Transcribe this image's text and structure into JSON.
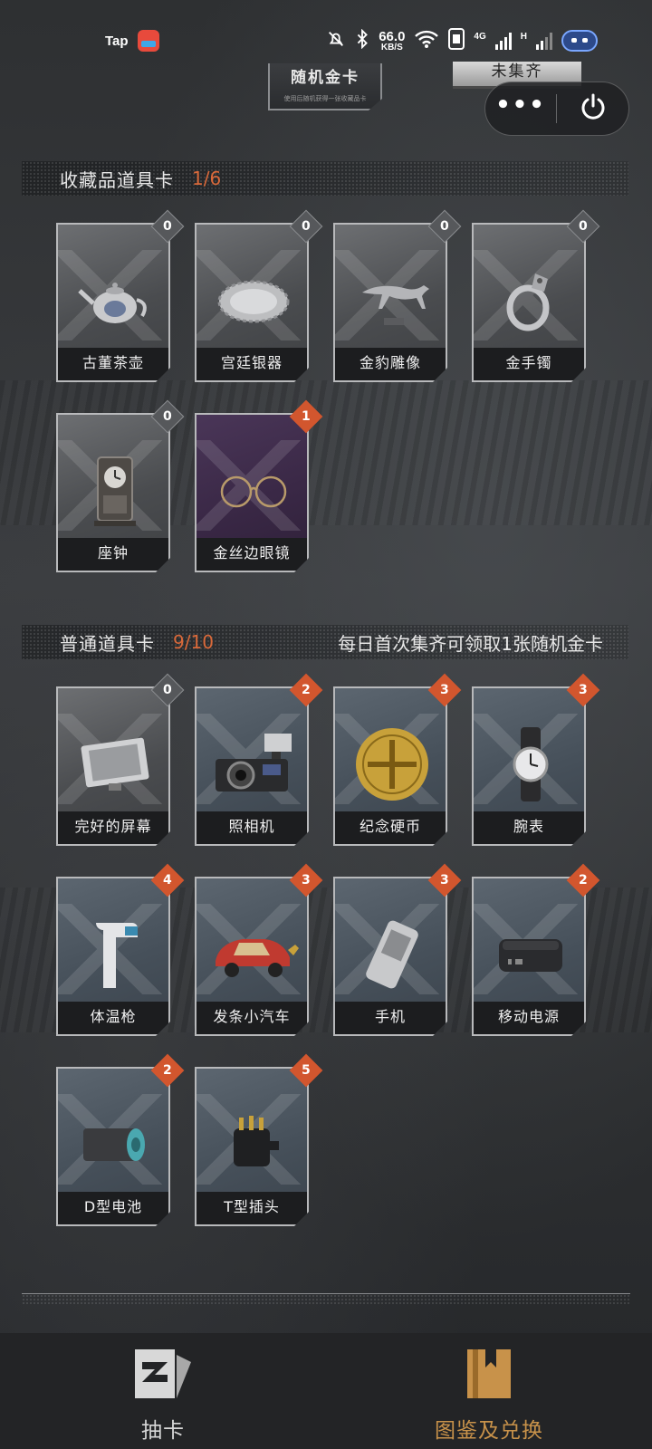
{
  "status_bar": {
    "app_label": "Tap",
    "speed_value": "66.0",
    "speed_unit": "KB/S",
    "net_label_1": "4G",
    "net_label_2": "H"
  },
  "header": {
    "gold_card_title": "随机金卡",
    "gold_card_subtitle": "使用后随机获得一张收藏品卡",
    "status_tag": "未集齐"
  },
  "collectibles": {
    "title": "收藏品道具卡",
    "count": "1/6",
    "cards": [
      {
        "label": "古董茶壶",
        "badge": "0"
      },
      {
        "label": "宫廷银器",
        "badge": "0"
      },
      {
        "label": "金豹雕像",
        "badge": "0"
      },
      {
        "label": "金手镯",
        "badge": "0"
      },
      {
        "label": "座钟",
        "badge": "0"
      },
      {
        "label": "金丝边眼镜",
        "badge": "1"
      }
    ]
  },
  "common": {
    "title": "普通道具卡",
    "count": "9/10",
    "note": "每日首次集齐可领取1张随机金卡",
    "cards": [
      {
        "label": "完好的屏幕",
        "badge": "0"
      },
      {
        "label": "照相机",
        "badge": "2"
      },
      {
        "label": "纪念硬币",
        "badge": "3"
      },
      {
        "label": "腕表",
        "badge": "3"
      },
      {
        "label": "体温枪",
        "badge": "4"
      },
      {
        "label": "发条小汽车",
        "badge": "3"
      },
      {
        "label": "手机",
        "badge": "3"
      },
      {
        "label": "移动电源",
        "badge": "2"
      },
      {
        "label": "D型电池",
        "badge": "2"
      },
      {
        "label": "T型插头",
        "badge": "5"
      }
    ]
  },
  "bottom_nav": {
    "draw_label": "抽卡",
    "collection_label": "图鉴及兑换"
  },
  "colors": {
    "accent": "#d2562e",
    "count_text": "#d9693a",
    "active_nav": "#c8924a"
  }
}
